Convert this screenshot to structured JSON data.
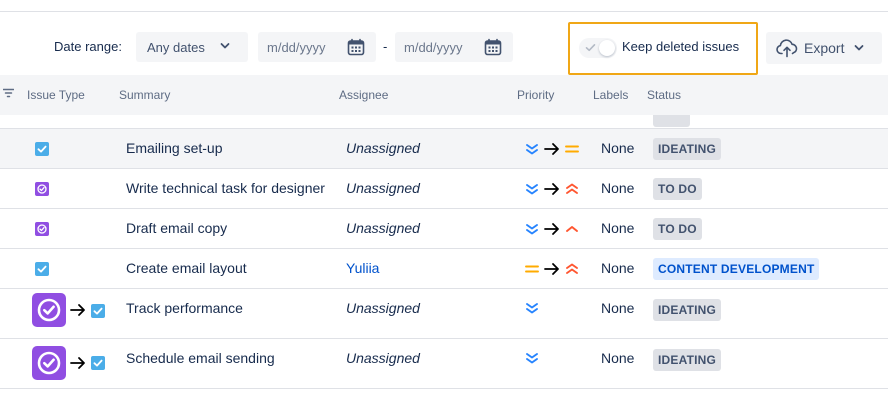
{
  "filters": {
    "date_range_label": "Date range:",
    "date_select_value": "Any dates",
    "date_from_placeholder": "m/dd/yyyy",
    "date_separator": "-",
    "date_to_placeholder": "m/dd/yyyy",
    "keep_deleted_label": "Keep deleted issues",
    "keep_deleted_on": false,
    "export_label": "Export"
  },
  "table": {
    "columns": {
      "issue_type": "Issue Type",
      "summary": "Summary",
      "assignee": "Assignee",
      "priority": "Priority",
      "labels": "Labels",
      "status": "Status"
    },
    "rows": [
      {
        "type": "task",
        "summary": "Emailing set-up",
        "assignee": "Unassigned",
        "priority_from": "lowest",
        "priority_to": "medium",
        "labels": "None",
        "status": "IDEATING"
      },
      {
        "type": "subtask",
        "summary": "Write technical task for designer",
        "assignee": "Unassigned",
        "priority_from": "lowest",
        "priority_to": "highest",
        "labels": "None",
        "status": "TO DO"
      },
      {
        "type": "subtask",
        "summary": "Draft email copy",
        "assignee": "Unassigned",
        "priority_from": "lowest",
        "priority_to": "high",
        "labels": "None",
        "status": "TO DO"
      },
      {
        "type": "task",
        "summary": "Create email layout",
        "assignee": "Yuliia",
        "priority_from": "medium",
        "priority_to": "highest",
        "labels": "None",
        "status": "CONTENT DEVELOPMENT"
      },
      {
        "type_from": "subtask",
        "type_to": "task",
        "summary": "Track performance",
        "assignee": "Unassigned",
        "priority": "lowest",
        "labels": "None",
        "status": "IDEATING"
      },
      {
        "type_from": "subtask",
        "type_to": "task",
        "summary": "Schedule email sending",
        "assignee": "Unassigned",
        "priority": "lowest",
        "labels": "None",
        "status": "IDEATING"
      }
    ]
  },
  "icons": {
    "filter": "filter-icon",
    "chevron": "chevron-down-icon",
    "calendar": "calendar-icon",
    "export": "cloud-upload-icon",
    "task": "task-checkbox-icon",
    "subtask": "subtask-circle-check-icon",
    "change_arrow": "arrow-right-icon"
  },
  "colors": {
    "task": "#4bade8",
    "subtask": "#904ee2",
    "priority_lowest": "#2684ff",
    "priority_medium": "#ffab00",
    "priority_high": "#ff5630",
    "highlight": "#f0a716",
    "status_blue_text": "#0052cc",
    "assignee_link": "#0052cc"
  }
}
